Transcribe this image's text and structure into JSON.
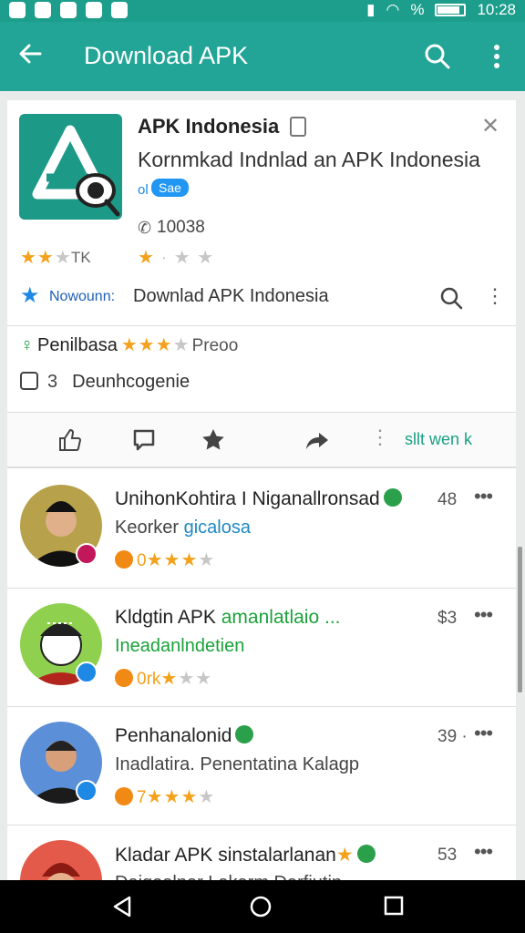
{
  "status_bar": {
    "left_icons": [
      "notification-icon",
      "whatsapp-icon",
      "gallery-icon",
      "mail-icon",
      "messenger-icon"
    ],
    "signal": "%",
    "time": "10:28"
  },
  "app_bar": {
    "title": "Download APK",
    "color": "#22a596"
  },
  "app_card": {
    "title": "APK Indonesia",
    "subtitle": "Kornmkad Indnlad an APK Indonesia",
    "chip_prefix": "ol",
    "chip": "Sae",
    "downloads": "10038",
    "rating_label": "TK",
    "rating1_stars": 2,
    "rating2_stars": 1
  },
  "link_row": {
    "small_text": "Nowounn:",
    "name": "Downlad APK Indonesia"
  },
  "review_row": {
    "name": "Penilbasa",
    "stars": 3,
    "tag": "Preoo"
  },
  "category_row": {
    "number": "3",
    "text": "Deunhcogenie"
  },
  "action_bar": {
    "label": "sllt wen k"
  },
  "list_items": [
    {
      "title": "UnihonKohtira I Niganallronsad",
      "title_extra": "",
      "number": "48",
      "subtitle_prefix": "Keorker ",
      "subtitle_link": "gicalosa",
      "rating_text": "0",
      "stars": 3,
      "avatar_bg": "#b7a14a",
      "badge_color": "#c2185b"
    },
    {
      "title": "Kldgtin APK ",
      "title_extra": "amanlatlaio ...",
      "number": "$3",
      "subtitle_prefix": "",
      "subtitle_link": "Ineadanlndetien",
      "rating_text": "0rk",
      "stars": 1,
      "avatar_bg": "#8fd14f",
      "badge_color": "#1e88e5"
    },
    {
      "title": "Penhanalonid",
      "title_extra": "",
      "number": "39 ·",
      "subtitle_prefix": "Inadlatira. Penentatina Kalagp",
      "subtitle_link": "",
      "rating_text": "7",
      "stars": 3,
      "avatar_bg": "#5b8fd8",
      "badge_color": "#1e88e5"
    },
    {
      "title": "Kladar APK sinstalarlanan",
      "title_extra": "",
      "number": "53",
      "subtitle_prefix": "Daigealnar Lakarm Darfiutin",
      "subtitle_link": "",
      "rating_text": "",
      "stars": 0,
      "avatar_bg": "#e35a4a",
      "badge_color": "#2ba04a"
    }
  ]
}
